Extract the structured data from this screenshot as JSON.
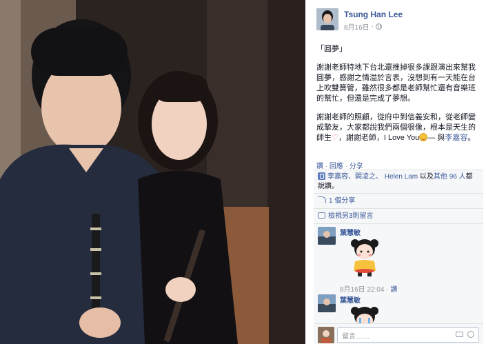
{
  "post": {
    "author_name": "Tsung Han Lee",
    "date": "8月16日",
    "audience_separator": "·",
    "audience_icon": "globe-icon",
    "title": "「圓夢」",
    "paragraph1": "謝謝老師特地下台北還推掉很多課跟演出來幫我圓夢，感謝之情溢於言表，沒想到有一天能在台上吹雙簧管，雖然很多都是老師幫忙還有音樂班的幫忙，但還是完成了夢想。",
    "paragraph2_text": "謝謝老師的照顧，從府中到信義安和，從老師變成摯友，大家都說我們兩個很像，根本是天生的師生",
    "paragraph2_heart": "♡",
    "paragraph2_thanks": "，謝謝老師，I Love You",
    "paragraph2_with": "— 與",
    "paragraph2_tagged": "李嘉容",
    "paragraph2_end": "。"
  },
  "actions": {
    "like": "讚",
    "comment": "回應",
    "share": "分享",
    "separator": "·"
  },
  "likes": {
    "names": "李嘉容、闕凌之、 Helen Lam",
    "middle": "以及",
    "others": "其他 96 人",
    "suffix": "都說讚。"
  },
  "shares": {
    "label": "1 個分享"
  },
  "more_comments": {
    "label": "檢視另3則留言"
  },
  "comments": [
    {
      "name": "葉慧敏",
      "date": "8月16日 22:04",
      "separator": "·",
      "like": "讚"
    },
    {
      "name": "葉慧敏"
    }
  ],
  "input": {
    "placeholder": "留言……"
  },
  "colors": {
    "link": "#3b5998",
    "meta": "#90949c",
    "ufi_bg": "#f6f7f9"
  }
}
